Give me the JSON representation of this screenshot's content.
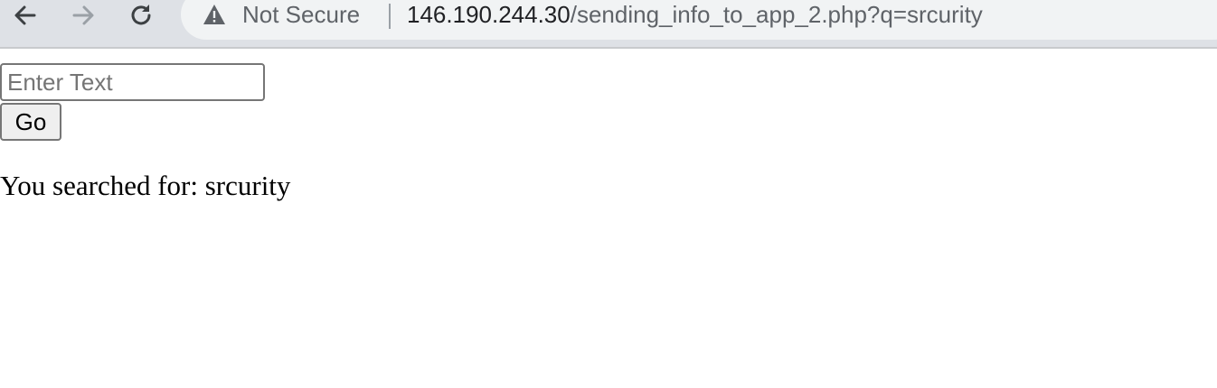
{
  "browser": {
    "security_label": "Not Secure",
    "url_host": "146.190.244.30",
    "url_path": "/sending_info_to_app_2.php?q=srcurity",
    "icons": {
      "back": "back-arrow-icon",
      "forward": "forward-arrow-icon",
      "reload": "reload-icon",
      "security": "warning-triangle-icon"
    }
  },
  "form": {
    "input_placeholder": "Enter Text",
    "input_value": "",
    "go_label": "Go"
  },
  "result": {
    "text": "You searched for: srcurity"
  },
  "colors": {
    "toolbar_bg": "#dee1e6",
    "address_bar_bg": "#f1f3f4",
    "muted_text": "#5f6368",
    "primary_text": "#202124"
  }
}
